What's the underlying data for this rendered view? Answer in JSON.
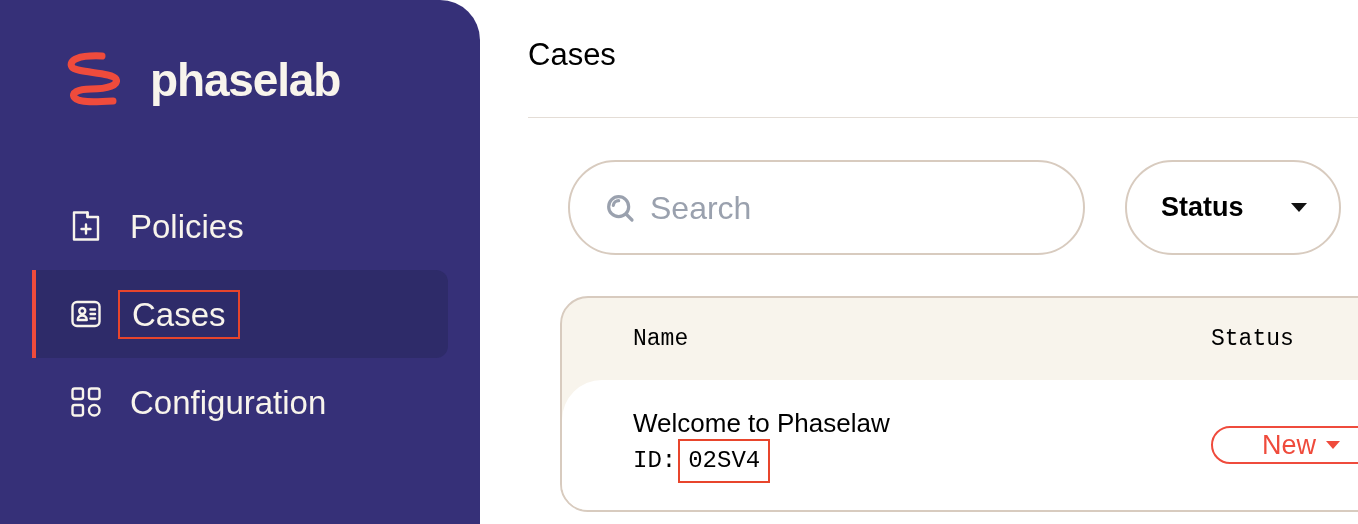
{
  "logo": {
    "text": "phaselab"
  },
  "sidebar": {
    "items": [
      {
        "label": "Policies",
        "kind": "folder",
        "selected": false,
        "highlighted": false
      },
      {
        "label": "Cases",
        "kind": "contact",
        "selected": true,
        "highlighted": true
      },
      {
        "label": "Configuration",
        "kind": "grid",
        "selected": false,
        "highlighted": false
      }
    ]
  },
  "page": {
    "title": "Cases"
  },
  "search": {
    "placeholder": "Search"
  },
  "status_filter": {
    "label": "Status"
  },
  "table": {
    "columns": [
      "Name",
      "Status"
    ],
    "rows": [
      {
        "name": "Welcome to Phaselaw",
        "id_label": "ID:",
        "id": "02SV4",
        "id_highlighted": true,
        "status": "New"
      }
    ]
  }
}
